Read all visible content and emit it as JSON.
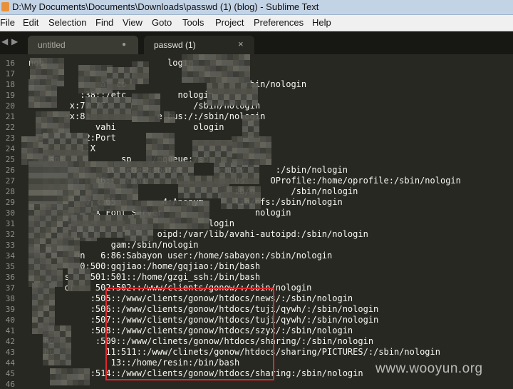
{
  "window": {
    "title": "D:\\My Documents\\Documents\\Downloads\\passwd (1) (blog) - Sublime Text"
  },
  "menu": [
    "File",
    "Edit",
    "Selection",
    "Find",
    "View",
    "Goto",
    "Tools",
    "Project",
    "Preferences",
    "Help"
  ],
  "tabs": [
    {
      "label": "untitled",
      "close_glyph": "●",
      "active": false
    },
    {
      "label": "passwd (1)",
      "close_glyph": "×",
      "active": true
    }
  ],
  "nav_arrows": {
    "left": "◀",
    "right": "▶"
  },
  "watermark": "www.wooyun.org",
  "editor": {
    "lines": [
      {
        "number": "16",
        "text": "nob                        login"
      },
      {
        "number": "17",
        "text": ""
      },
      {
        "number": "18",
        "text": "              al co                       rbin/nologin"
      },
      {
        "number": "19",
        "text": "          :38::/etc          nologin"
      },
      {
        "number": "20",
        "text": "        x:77:77:                /sbin/nologin"
      },
      {
        "number": "21",
        "text": "       :x:81             e bus:/:/sbin/nologin"
      },
      {
        "number": "22",
        "text": "             vahi               ologin"
      },
      {
        "number": "23",
        "text": "           2:Port"
      },
      {
        "number": "24",
        "text": "          1:X"
      },
      {
        "number": "25",
        "text": "   esp:           sp    /mqueue:/sb"
      },
      {
        "number": "26",
        "text": "               ivilege-separat       empty      :/sbin/nologin"
      },
      {
        "number": "27",
        "text": "             16:Special        e      e us     OProfile:/home/oprofile:/sbin/nologin"
      },
      {
        "number": "28",
        "text": "                                        ib/n       /sbin/nologin"
      },
      {
        "number": "29",
        "text": "           v:x:65         4:Anonym      lib/nfs:/sbin/nologin"
      },
      {
        "number": "30",
        "text": "             X Font Server                  nologin"
      },
      {
        "number": "31",
        "text": "                                   login"
      },
      {
        "number": "32",
        "text": "                         oipd:/var/lib/avahi-autoipd:/sbin/nologin"
      },
      {
        "number": "33",
        "text": "                gam:/sbin/nologin"
      },
      {
        "number": "34",
        "text": "         on   6:86:Sabayon user:/home/sabayon:/sbin/nologin"
      },
      {
        "number": "35",
        "text": "          0:500:gqjiao:/home/gqjiao:/bin/bash"
      },
      {
        "number": "36",
        "text": "       s    501:501::/home/gzgi_ssh:/bin/bash"
      },
      {
        "number": "37",
        "text": "       or    502:502::/www/clients/gonow/:/sbin/nologin"
      },
      {
        "number": "38",
        "text": "            :505::/www/clients/gonow/htdocs/news/:/sbin/nologin"
      },
      {
        "number": "39",
        "text": "            :506::/www/clients/gonow/htdocs/tuji/qywh/:/sbin/nologin"
      },
      {
        "number": "40",
        "text": "            :507::/www/clients/gonow/htdocs/tuji/qywh/:/sbin/nologin"
      },
      {
        "number": "41",
        "text": "            :508::/www/clients/gonow/htdocs/szyx/:/sbin/nologin"
      },
      {
        "number": "42",
        "text": "   ho        :509::/www/clinets/gonow/htdocs/sharing/:/sbin/nologin"
      },
      {
        "number": "43",
        "text": "   hu          11:511::/www/clinets/gonow/htdocs/sharing/PICTURES/:/sbin/nologin"
      },
      {
        "number": "44",
        "text": "                13::/home/resin:/bin/bash"
      },
      {
        "number": "45",
        "text": "            :514::/www/clients/gonow/htdocs/sharing:/sbin/nologin"
      },
      {
        "number": "46",
        "text": ""
      }
    ]
  }
}
